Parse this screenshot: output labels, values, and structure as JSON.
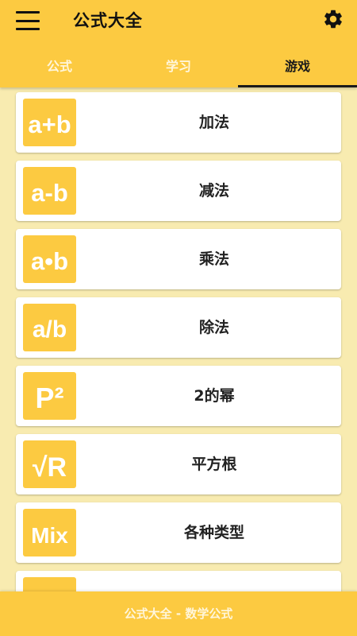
{
  "app": {
    "title": "公式大全",
    "menu_icon": "hamburger-menu-icon",
    "settings_icon": "gear-icon"
  },
  "tabs": [
    {
      "label": "公式",
      "active": false
    },
    {
      "label": "学习",
      "active": false
    },
    {
      "label": "游戏",
      "active": true
    }
  ],
  "games": [
    {
      "label": "加法",
      "icon": "addition-icon",
      "icon_text": "a+b"
    },
    {
      "label": "减法",
      "icon": "subtraction-icon",
      "icon_text": "a-b"
    },
    {
      "label": "乘法",
      "icon": "multiplication-icon",
      "icon_text": "a•b"
    },
    {
      "label": "除法",
      "icon": "division-icon",
      "icon_text": "a/b"
    },
    {
      "label": "2的幂",
      "icon": "power-icon",
      "icon_text": "P²"
    },
    {
      "label": "平方根",
      "icon": "square-root-icon",
      "icon_text": "√R"
    },
    {
      "label": "各种类型",
      "icon": "mix-icon",
      "icon_text": "Mix"
    }
  ],
  "footer": {
    "text": "公式大全 - 数学公式"
  },
  "colors": {
    "accent": "#FCCA41",
    "background": "#F8EBB0",
    "card": "#FFFFFF",
    "text_dark": "#222222",
    "tab_inactive": "#FFF6DC"
  }
}
